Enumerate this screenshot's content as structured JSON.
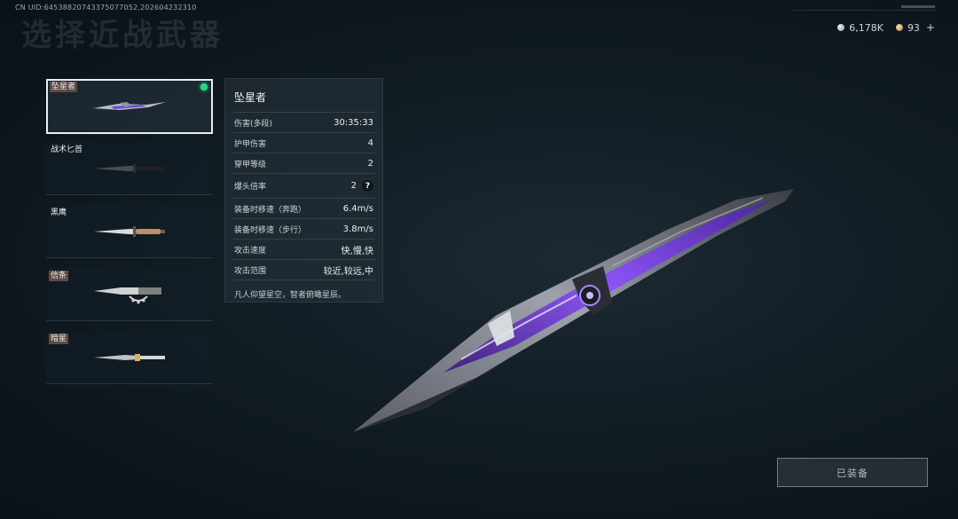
{
  "uid_text": "CN UID:6453882074337507705​2,20260423​2310",
  "page_title": "选择近战武器",
  "currency": {
    "silver": "6,178K",
    "gold": "93",
    "plus": "+"
  },
  "weapons": [
    {
      "name": "坠星者",
      "tagged": true,
      "selected": true,
      "equipped": true
    },
    {
      "name": "战术匕首",
      "tagged": false
    },
    {
      "name": "黑鹰",
      "tagged": false
    },
    {
      "name": "信条",
      "tagged": true
    },
    {
      "name": "暗星",
      "tagged": true
    }
  ],
  "details": {
    "title": "坠星者",
    "stats": [
      {
        "label": "伤害(多段)",
        "value": "30:35:33"
      },
      {
        "label": "护甲伤害",
        "value": "4"
      },
      {
        "label": "穿甲等级",
        "value": "2"
      },
      {
        "label": "爆头倍率",
        "value": "2",
        "help": "?"
      },
      {
        "label": "装备时移速（奔跑）",
        "value": "6.4m/s"
      },
      {
        "label": "装备时移速（步行）",
        "value": "3.8m/s"
      },
      {
        "label": "攻击速度",
        "value": "快,慢,快"
      },
      {
        "label": "攻击范围",
        "value": "较近,较远,中"
      }
    ],
    "flavor": "凡人仰望星空，智者俯瞰星辰。"
  },
  "equip_button": "已装备",
  "colors": {
    "accent_green": "#2fd586",
    "purple_glow": "#7b3cff"
  }
}
